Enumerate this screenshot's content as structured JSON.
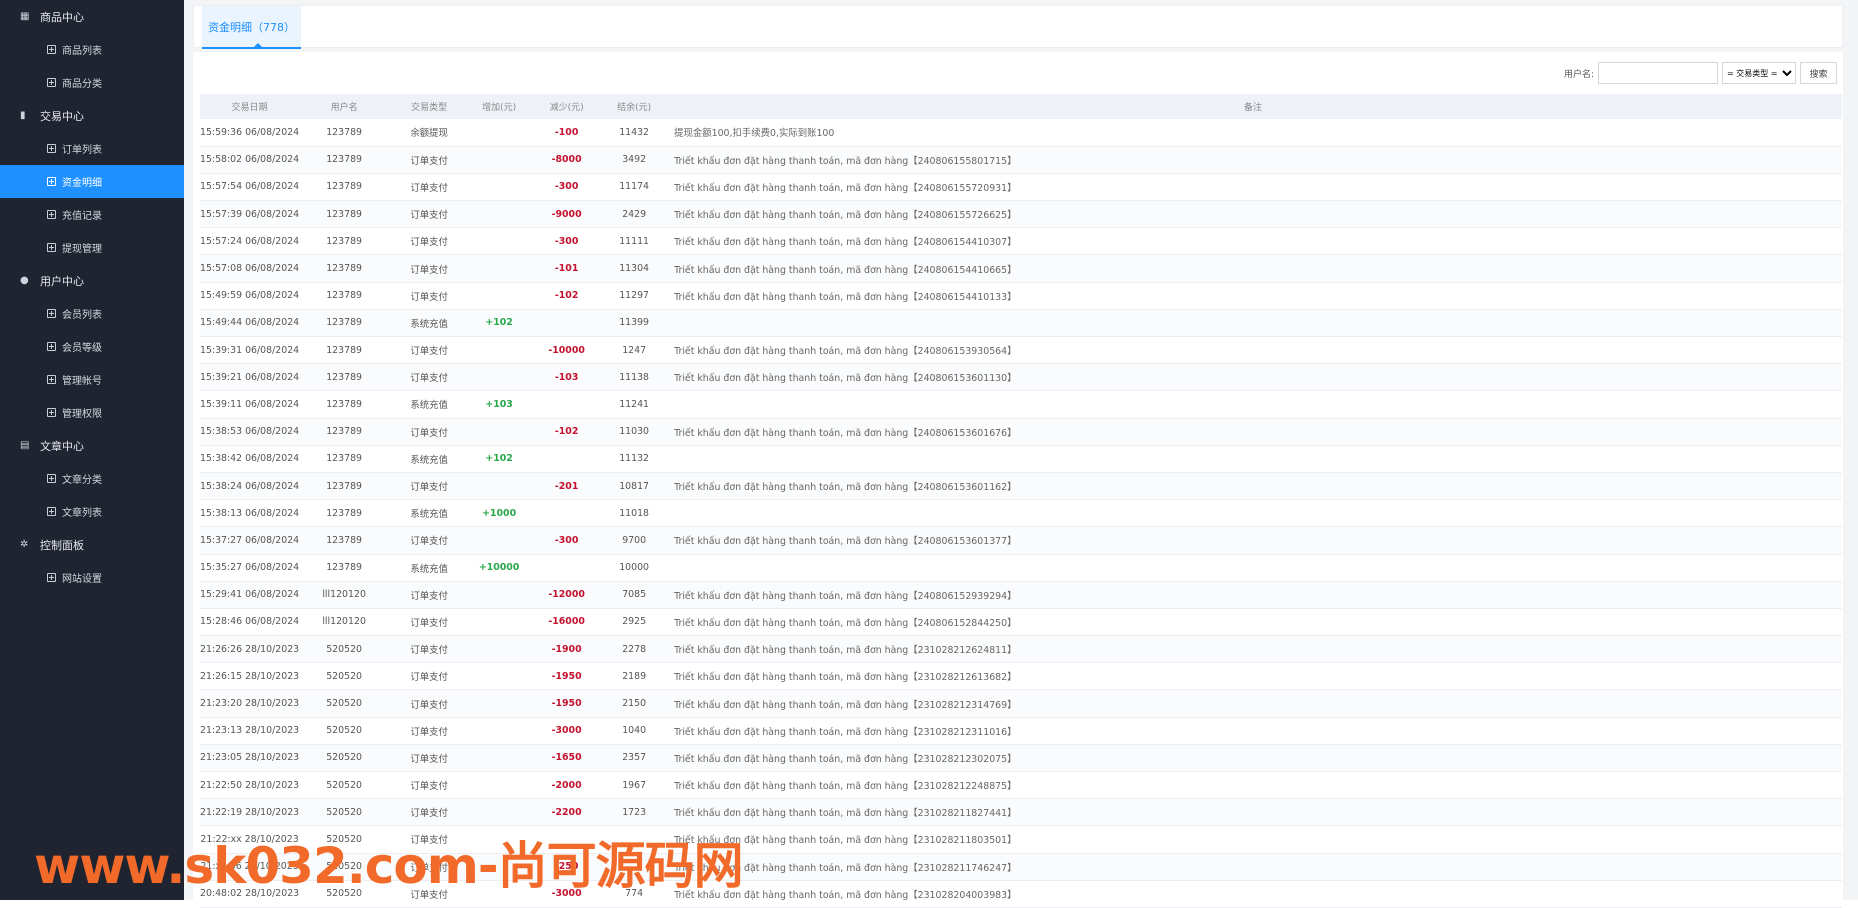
{
  "sidebar": {
    "groups": [
      {
        "label": "商品中心",
        "icon": "grid-icon",
        "items": [
          "商品列表",
          "商品分类"
        ]
      },
      {
        "label": "交易中心",
        "icon": "bar-chart-icon",
        "items": [
          "订单列表",
          "资金明细",
          "充值记录",
          "提现管理"
        ]
      },
      {
        "label": "用户中心",
        "icon": "user-icon",
        "items": [
          "会员列表",
          "会员等级",
          "管理帐号",
          "管理权限"
        ]
      },
      {
        "label": "文章中心",
        "icon": "document-icon",
        "items": [
          "文章分类",
          "文章列表"
        ]
      },
      {
        "label": "控制面板",
        "icon": "gear-icon",
        "items": [
          "网站设置"
        ]
      }
    ],
    "active_item": "资金明细"
  },
  "tab": {
    "label": "资金明细（778）"
  },
  "toolbar": {
    "username_label": "用户名:",
    "username_value": "",
    "type_select": "= 交易类型 =",
    "search_label": "搜索"
  },
  "table": {
    "headers": [
      "交易日期",
      "用户名",
      "交易类型",
      "增加(元)",
      "减少(元)",
      "结余(元)",
      "备注"
    ],
    "rows": [
      [
        "15:59:36 06/08/2024",
        "123789",
        "余额提现",
        "",
        "-100",
        "11432",
        "提现金额100,扣手续费0,实际到账100"
      ],
      [
        "15:58:02 06/08/2024",
        "123789",
        "订单支付",
        "",
        "-8000",
        "3492",
        "Triết khấu đơn đặt hàng thanh toán, mã đơn hàng【240806155801715】"
      ],
      [
        "15:57:54 06/08/2024",
        "123789",
        "订单支付",
        "",
        "-300",
        "11174",
        "Triết khấu đơn đặt hàng thanh toán, mã đơn hàng【240806155720931】"
      ],
      [
        "15:57:39 06/08/2024",
        "123789",
        "订单支付",
        "",
        "-9000",
        "2429",
        "Triết khấu đơn đặt hàng thanh toán, mã đơn hàng【240806155726625】"
      ],
      [
        "15:57:24 06/08/2024",
        "123789",
        "订单支付",
        "",
        "-300",
        "11111",
        "Triết khấu đơn đặt hàng thanh toán, mã đơn hàng【240806154410307】"
      ],
      [
        "15:57:08 06/08/2024",
        "123789",
        "订单支付",
        "",
        "-101",
        "11304",
        "Triết khấu đơn đặt hàng thanh toán, mã đơn hàng【240806154410665】"
      ],
      [
        "15:49:59 06/08/2024",
        "123789",
        "订单支付",
        "",
        "-102",
        "11297",
        "Triết khấu đơn đặt hàng thanh toán, mã đơn hàng【240806154410133】"
      ],
      [
        "15:49:44 06/08/2024",
        "123789",
        "系统充值",
        "+102",
        "",
        "11399",
        ""
      ],
      [
        "15:39:31 06/08/2024",
        "123789",
        "订单支付",
        "",
        "-10000",
        "1247",
        "Triết khấu đơn đặt hàng thanh toán, mã đơn hàng【240806153930564】"
      ],
      [
        "15:39:21 06/08/2024",
        "123789",
        "订单支付",
        "",
        "-103",
        "11138",
        "Triết khấu đơn đặt hàng thanh toán, mã đơn hàng【240806153601130】"
      ],
      [
        "15:39:11 06/08/2024",
        "123789",
        "系统充值",
        "+103",
        "",
        "11241",
        ""
      ],
      [
        "15:38:53 06/08/2024",
        "123789",
        "订单支付",
        "",
        "-102",
        "11030",
        "Triết khấu đơn đặt hàng thanh toán, mã đơn hàng【240806153601676】"
      ],
      [
        "15:38:42 06/08/2024",
        "123789",
        "系统充值",
        "+102",
        "",
        "11132",
        ""
      ],
      [
        "15:38:24 06/08/2024",
        "123789",
        "订单支付",
        "",
        "-201",
        "10817",
        "Triết khấu đơn đặt hàng thanh toán, mã đơn hàng【240806153601162】"
      ],
      [
        "15:38:13 06/08/2024",
        "123789",
        "系统充值",
        "+1000",
        "",
        "11018",
        ""
      ],
      [
        "15:37:27 06/08/2024",
        "123789",
        "订单支付",
        "",
        "-300",
        "9700",
        "Triết khấu đơn đặt hàng thanh toán, mã đơn hàng【240806153601377】"
      ],
      [
        "15:35:27 06/08/2024",
        "123789",
        "系统充值",
        "+10000",
        "",
        "10000",
        ""
      ],
      [
        "15:29:41 06/08/2024",
        "lll120120",
        "订单支付",
        "",
        "-12000",
        "7085",
        "Triết khấu đơn đặt hàng thanh toán, mã đơn hàng【240806152939294】"
      ],
      [
        "15:28:46 06/08/2024",
        "lll120120",
        "订单支付",
        "",
        "-16000",
        "2925",
        "Triết khấu đơn đặt hàng thanh toán, mã đơn hàng【240806152844250】"
      ],
      [
        "21:26:26 28/10/2023",
        "520520",
        "订单支付",
        "",
        "-1900",
        "2278",
        "Triết khấu đơn đặt hàng thanh toán, mã đơn hàng【231028212624811】"
      ],
      [
        "21:26:15 28/10/2023",
        "520520",
        "订单支付",
        "",
        "-1950",
        "2189",
        "Triết khấu đơn đặt hàng thanh toán, mã đơn hàng【231028212613682】"
      ],
      [
        "21:23:20 28/10/2023",
        "520520",
        "订单支付",
        "",
        "-1950",
        "2150",
        "Triết khấu đơn đặt hàng thanh toán, mã đơn hàng【231028212314769】"
      ],
      [
        "21:23:13 28/10/2023",
        "520520",
        "订单支付",
        "",
        "-3000",
        "1040",
        "Triết khấu đơn đặt hàng thanh toán, mã đơn hàng【231028212311016】"
      ],
      [
        "21:23:05 28/10/2023",
        "520520",
        "订单支付",
        "",
        "-1650",
        "2357",
        "Triết khấu đơn đặt hàng thanh toán, mã đơn hàng【231028212302075】"
      ],
      [
        "21:22:50 28/10/2023",
        "520520",
        "订单支付",
        "",
        "-2000",
        "1967",
        "Triết khấu đơn đặt hàng thanh toán, mã đơn hàng【231028212248875】"
      ],
      [
        "21:22:19 28/10/2023",
        "520520",
        "订单支付",
        "",
        "-2200",
        "1723",
        "Triết khấu đơn đặt hàng thanh toán, mã đơn hàng【231028211827441】"
      ],
      [
        "21:22:xx 28/10/2023",
        "520520",
        "订单支付",
        "",
        "",
        "",
        "Triết khấu đơn đặt hàng thanh toán, mã đơn hàng【231028211803501】"
      ],
      [
        "21:xx:56 28/10/2023",
        "520520",
        "订单支付",
        "",
        "-250",
        "",
        "Triết khấu đơn đặt hàng thanh toán, mã đơn hàng【231028211746247】"
      ],
      [
        "20:48:02 28/10/2023",
        "520520",
        "订单支付",
        "",
        "-3000",
        "774",
        "Triết khấu đơn đặt hàng thanh toán, mã đơn hàng【231028204003983】"
      ]
    ]
  },
  "watermark": "www.sk032.com-尚可源码网"
}
